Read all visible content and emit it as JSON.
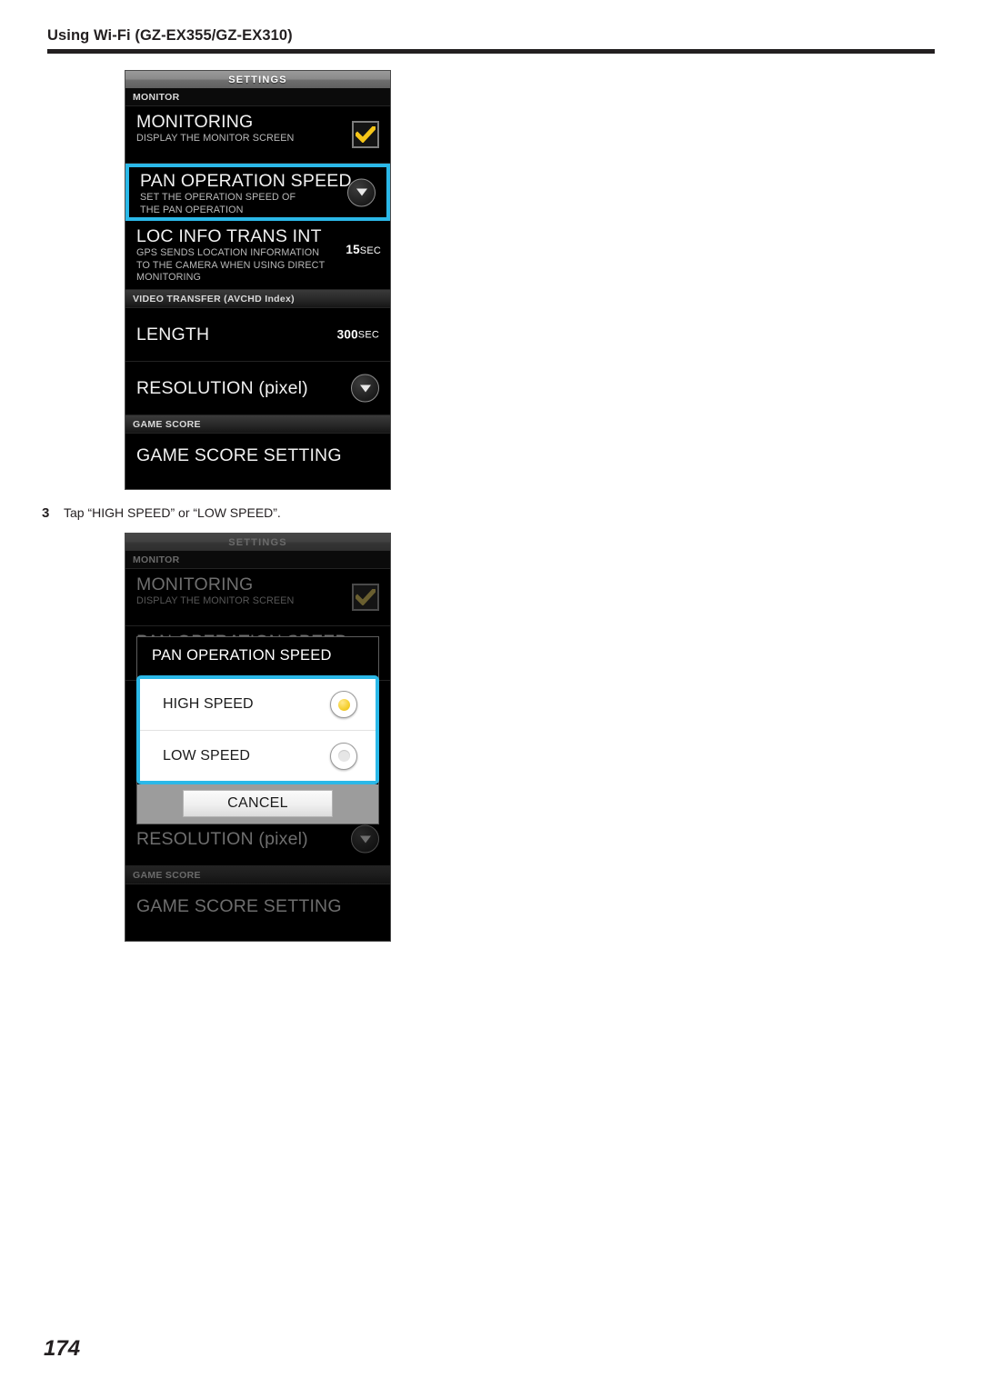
{
  "header": {
    "title": "Using Wi-Fi (GZ-EX355/GZ-EX310)"
  },
  "step": {
    "number": "3",
    "text": "Tap “HIGH SPEED” or “LOW SPEED”."
  },
  "page_number": "174",
  "colors": {
    "highlight": "#2bb8e8",
    "checkbox_check": "#f5c518",
    "radio_selected": "#f5cf2e",
    "screen_background": "#000000",
    "titlebar": "#8b8b8b"
  },
  "screenshot_1": {
    "titlebar": "SETTINGS",
    "sections": [
      {
        "label": "MONITOR",
        "rows": [
          {
            "title": "MONITORING",
            "subtitle": "DISPLAY THE MONITOR SCREEN",
            "control": "checkbox-checked",
            "highlighted": false
          },
          {
            "title": "PAN OPERATION SPEED",
            "subtitle": "SET THE OPERATION SPEED OF\nTHE PAN OPERATION",
            "control": "drop-button",
            "highlighted": true
          },
          {
            "title": "LOC INFO TRANS INT",
            "subtitle": "GPS SENDS LOCATION INFORMATION\nTO THE CAMERA WHEN USING DIRECT\nMONITORING",
            "control": "value",
            "value_number": "15",
            "value_unit": "SEC",
            "highlighted": false
          }
        ]
      },
      {
        "label": "VIDEO TRANSFER (AVCHD Index)",
        "rows": [
          {
            "title": "LENGTH",
            "subtitle": "",
            "control": "value",
            "value_number": "300",
            "value_unit": "SEC",
            "highlighted": false
          },
          {
            "title": "RESOLUTION (pixel)",
            "subtitle": "",
            "control": "drop-button",
            "highlighted": false
          }
        ]
      },
      {
        "label": "GAME SCORE",
        "rows": [
          {
            "title": "GAME SCORE SETTING",
            "subtitle": "",
            "control": "none",
            "highlighted": false
          }
        ]
      }
    ]
  },
  "screenshot_2": {
    "titlebar": "SETTINGS",
    "background_rows": {
      "section_monitor": "MONITOR",
      "monitoring_title": "MONITORING",
      "monitoring_subtitle": "DISPLAY THE MONITOR SCREEN",
      "pan_title": "PAN OPERATION SPEED",
      "resolution_title": "RESOLUTION (pixel)",
      "section_game_score": "GAME SCORE",
      "game_score_title": "GAME SCORE SETTING"
    },
    "dialog": {
      "title": "PAN OPERATION SPEED",
      "options": [
        {
          "label": "HIGH SPEED",
          "selected": true
        },
        {
          "label": "LOW SPEED",
          "selected": false
        }
      ],
      "cancel_label": "CANCEL"
    }
  }
}
